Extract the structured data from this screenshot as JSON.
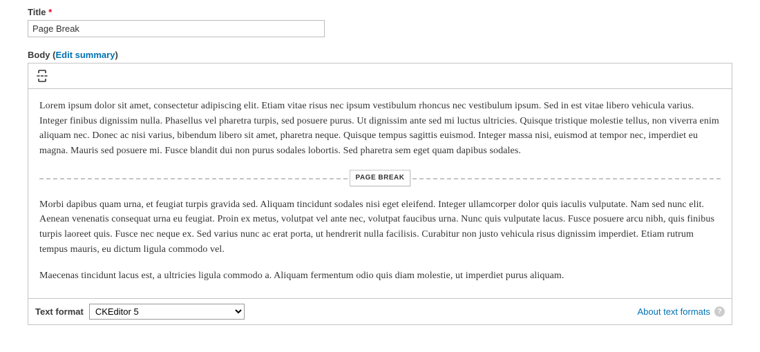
{
  "title": {
    "label": "Title",
    "required_marker": "*",
    "value": "Page Break"
  },
  "body": {
    "label_prefix": "Body ",
    "paren_open": "(",
    "edit_summary_label": "Edit summary",
    "paren_close": ")",
    "toolbar": {
      "page_break_button": "page-break"
    },
    "content": {
      "para1": "Lorem ipsum dolor sit amet, consectetur adipiscing elit. Etiam vitae risus nec ipsum vestibulum rhoncus nec vestibulum ipsum. Sed in est vitae libero vehicula varius. Integer finibus dignissim nulla. Phasellus vel pharetra turpis, sed posuere purus. Ut dignissim ante sed mi luctus ultricies. Quisque tristique molestie tellus, non viverra enim aliquam nec. Donec ac nisi varius, bibendum libero sit amet, pharetra neque. Quisque tempus sagittis euismod. Integer massa nisi, euismod at tempor nec, imperdiet eu magna. Mauris sed posuere mi. Fusce blandit dui non purus sodales lobortis. Sed pharetra sem eget quam dapibus sodales.",
      "page_break_label": "PAGE BREAK",
      "para2": "Morbi dapibus quam urna, et feugiat turpis gravida sed. Aliquam tincidunt sodales nisi eget eleifend. Integer ullamcorper dolor quis iaculis vulputate. Nam sed nunc elit. Aenean venenatis consequat urna eu feugiat. Proin ex metus, volutpat vel ante nec, volutpat faucibus urna. Nunc quis vulputate lacus. Fusce posuere arcu nibh, quis finibus turpis laoreet quis. Fusce nec neque ex. Sed varius nunc ac erat porta, ut hendrerit nulla facilisis. Curabitur non justo vehicula risus dignissim imperdiet. Etiam rutrum tempus mauris, eu dictum ligula commodo vel.",
      "para3": "Maecenas tincidunt lacus est, a ultricies ligula commodo a. Aliquam fermentum odio quis diam molestie, ut imperdiet purus aliquam."
    }
  },
  "footer": {
    "text_format_label": "Text format",
    "text_format_value": "CKEditor 5",
    "about_label": "About text formats",
    "help_char": "?"
  }
}
